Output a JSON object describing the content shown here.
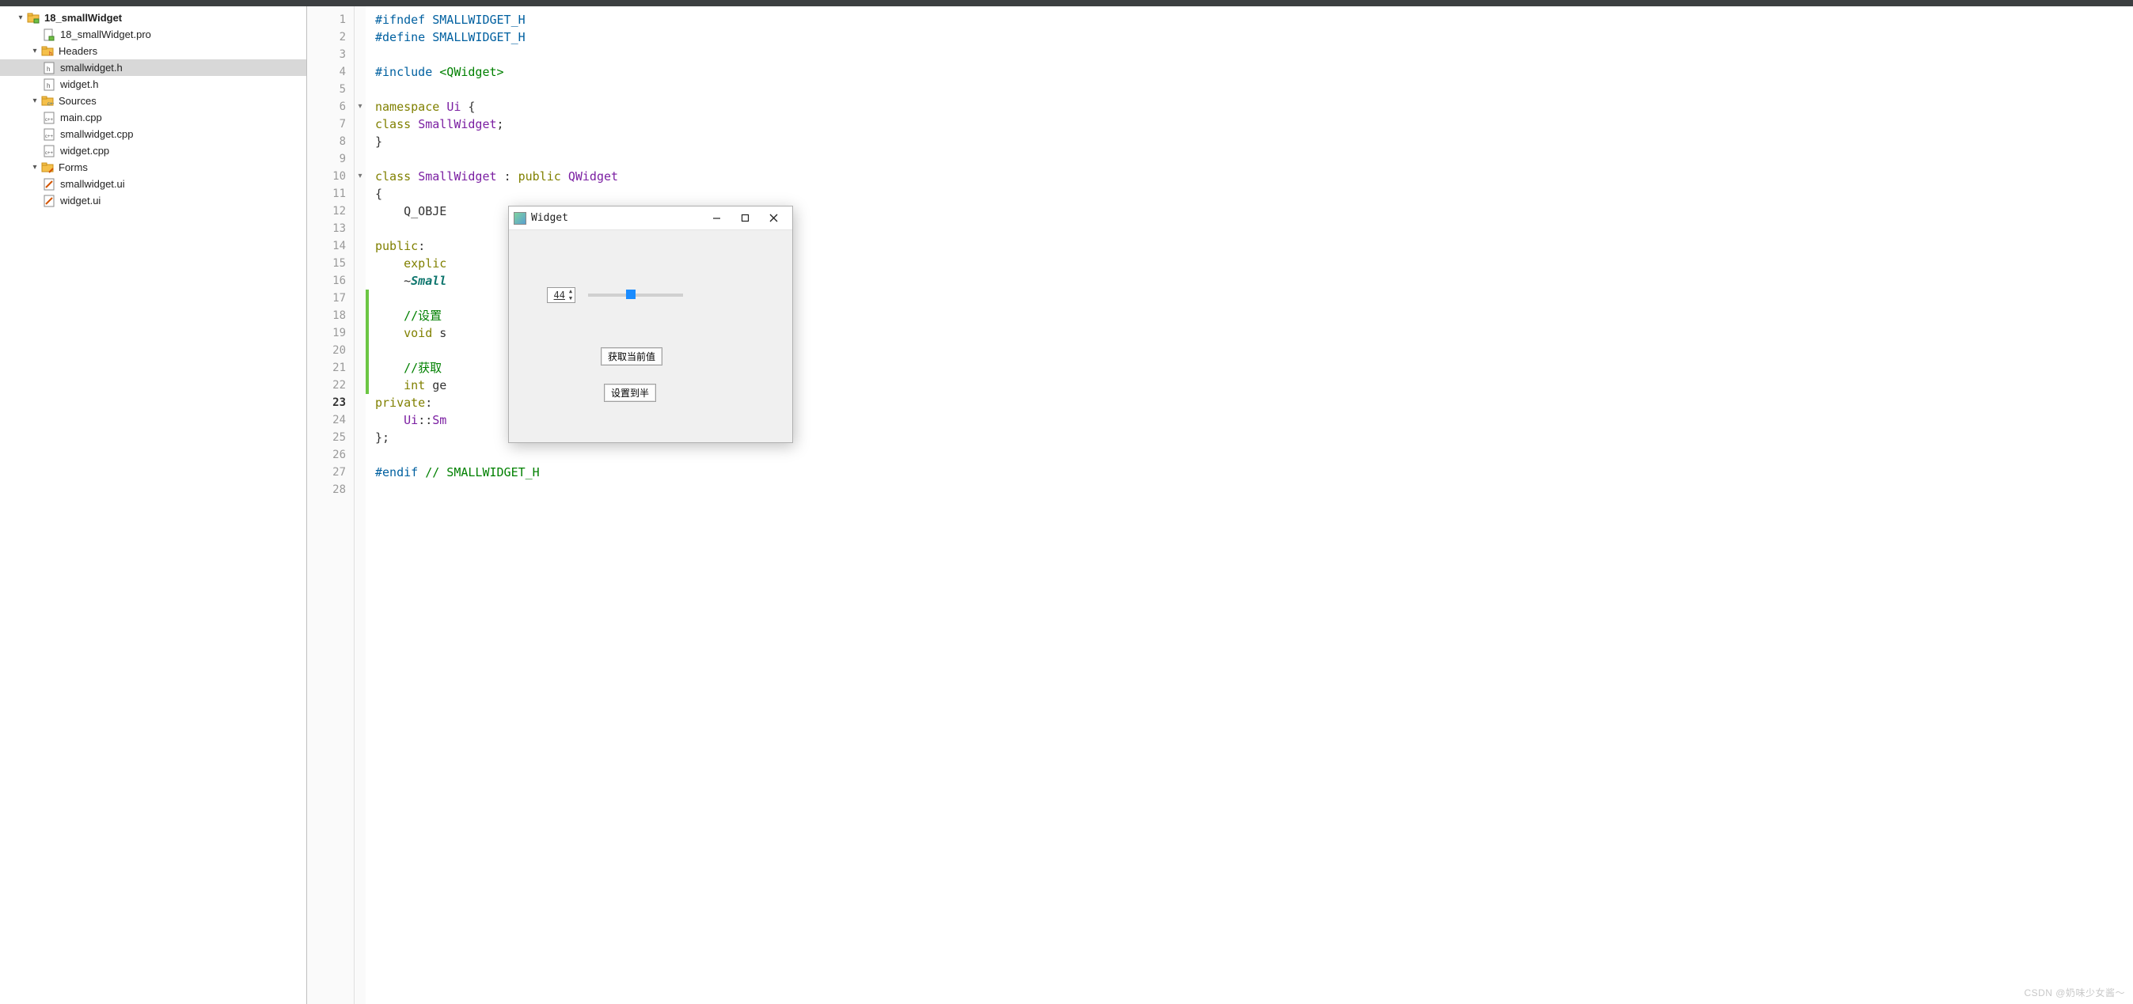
{
  "project": {
    "root": "18_smallWidget",
    "pro_file": "18_smallWidget.pro",
    "headers_label": "Headers",
    "headers": [
      "smallwidget.h",
      "widget.h"
    ],
    "sources_label": "Sources",
    "sources": [
      "main.cpp",
      "smallwidget.cpp",
      "widget.cpp"
    ],
    "forms_label": "Forms",
    "forms": [
      "smallwidget.ui",
      "widget.ui"
    ],
    "selected": "smallwidget.h"
  },
  "editor": {
    "current_line": 23,
    "fold_lines": [
      6,
      10
    ],
    "green_markers_start": 17,
    "green_markers_end": 22,
    "lines": [
      {
        "n": 1,
        "html": "<span class='pp'>#ifndef</span> <span class='pp'>SMALLWIDGET_H</span>"
      },
      {
        "n": 2,
        "html": "<span class='pp'>#define</span> <span class='pp'>SMALLWIDGET_H</span>"
      },
      {
        "n": 3,
        "html": ""
      },
      {
        "n": 4,
        "html": "<span class='pp'>#include</span> <span class='str'>&lt;QWidget&gt;</span>"
      },
      {
        "n": 5,
        "html": ""
      },
      {
        "n": 6,
        "html": "<span class='kw'>namespace</span> <span class='cls'>Ui</span> <span class='op'>{</span>"
      },
      {
        "n": 7,
        "html": "<span class='kw'>class</span> <span class='cls'>SmallWidget</span><span class='op'>;</span>"
      },
      {
        "n": 8,
        "html": "<span class='op'>}</span>"
      },
      {
        "n": 9,
        "html": ""
      },
      {
        "n": 10,
        "html": "<span class='kw'>class</span> <span class='cls'>SmallWidget</span> <span class='op'>:</span> <span class='kw'>public</span> <span class='cls'>QWidget</span>"
      },
      {
        "n": 11,
        "html": "<span class='op'>{</span>"
      },
      {
        "n": 12,
        "html": "    <span class='func'>Q_OBJE</span>"
      },
      {
        "n": 13,
        "html": ""
      },
      {
        "n": 14,
        "html": "<span class='kw'>public</span><span class='op'>:</span>"
      },
      {
        "n": 15,
        "html": "    <span class='kw'>explic</span>                                    <span class='op'>ullptr);</span>"
      },
      {
        "n": 16,
        "html": "    <span class='op'>~</span><span class='id'>Small</span>"
      },
      {
        "n": 17,
        "html": ""
      },
      {
        "n": 18,
        "html": "    <span class='cm'>//设置</span>"
      },
      {
        "n": 19,
        "html": "    <span class='kw'>void</span> <span class='func'>s</span>"
      },
      {
        "n": 20,
        "html": ""
      },
      {
        "n": 21,
        "html": "    <span class='cm'>//获取</span>"
      },
      {
        "n": 22,
        "html": "    <span class='kw'>int</span> <span class='func'>ge</span>"
      },
      {
        "n": 23,
        "html": "<span class='kw'>private</span><span class='op'>:</span>"
      },
      {
        "n": 24,
        "html": "    <span class='cls'>Ui</span><span class='op'>::</span><span class='cls'>Sm</span>"
      },
      {
        "n": 25,
        "html": "<span class='op'>};</span>"
      },
      {
        "n": 26,
        "html": ""
      },
      {
        "n": 27,
        "html": "<span class='pp'>#endif</span> <span class='cm'>// SMALLWIDGET_H</span>"
      },
      {
        "n": 28,
        "html": ""
      }
    ]
  },
  "runwin": {
    "title": "Widget",
    "spin_value": "44",
    "slider_percent": 44,
    "btn_get": "获取当前值",
    "btn_half": "设置到半"
  },
  "watermark": "CSDN @奶味少女酱～"
}
